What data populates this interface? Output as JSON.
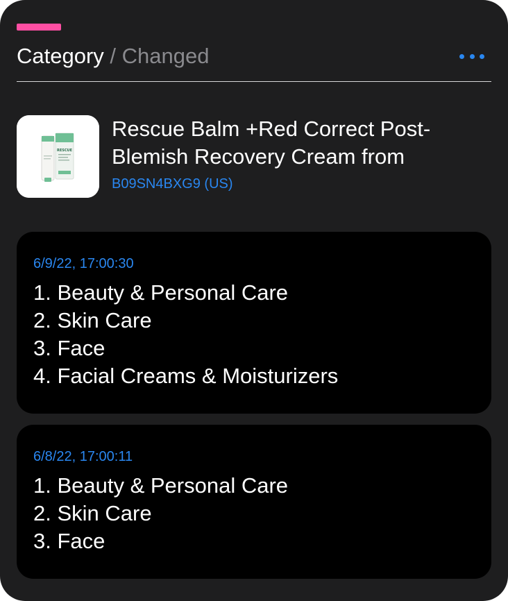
{
  "colors": {
    "accent": "#ff4fa3",
    "link": "#2a87f0",
    "card_bg": "#1e1e1f",
    "entry_bg": "#000000"
  },
  "header": {
    "title": "Category",
    "separator": "/",
    "subtitle": "Changed",
    "more_icon": "more-horizontal-icon"
  },
  "product": {
    "name": "Rescue Balm +Red Correct Post-Blemish Recovery Cream from",
    "asin_label": "B09SN4BXG9 (US)",
    "thumbnail_icon": "product-tube-icon",
    "thumbnail_text": "RESCUE"
  },
  "history": [
    {
      "date": "6/9/22, 17:00:30",
      "categories": [
        "1. Beauty & Personal Care",
        "2. Skin Care",
        "3. Face",
        "4. Facial Creams & Moisturizers"
      ]
    },
    {
      "date": "6/8/22, 17:00:11",
      "categories": [
        "1. Beauty & Personal Care",
        "2. Skin Care",
        "3. Face"
      ]
    }
  ]
}
